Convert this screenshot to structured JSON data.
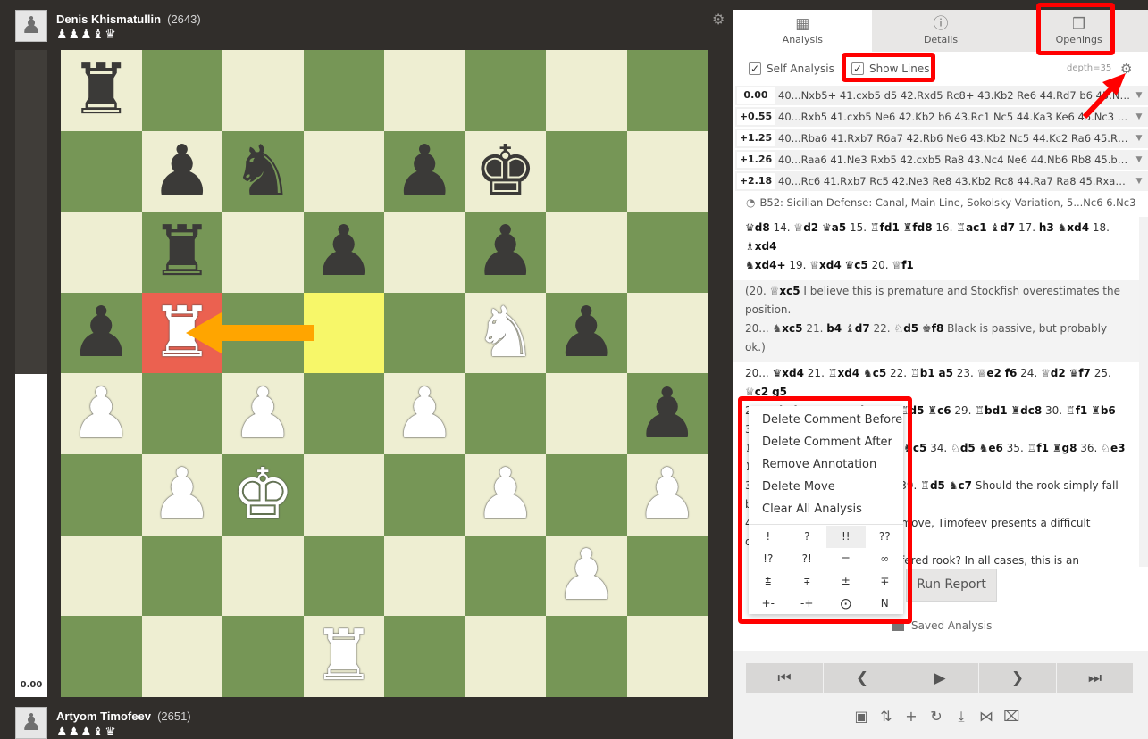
{
  "top_player": {
    "name": "Denis Khismatullin",
    "rating": "(2643)",
    "captured": "♟♟♟♝♛"
  },
  "bottom_player": {
    "name": "Artyom Timofeev",
    "rating": "(2651)",
    "captured": "♟♟♟♝♛"
  },
  "eval_bar": {
    "score": "0.00",
    "white_fraction": 0.5
  },
  "board": {
    "squares": [
      [
        "♜",
        "",
        "",
        "",
        "",
        "",
        "",
        ""
      ],
      [
        "",
        "♟",
        "♞",
        "",
        "♟",
        "♚",
        "",
        ""
      ],
      [
        "",
        "♜",
        "",
        "♟",
        "",
        "♟",
        "",
        ""
      ],
      [
        "♟",
        "♖",
        "",
        "",
        "",
        "♘",
        "♟",
        ""
      ],
      [
        "♙",
        "",
        "♙",
        "",
        "♙",
        "",
        "",
        "♟"
      ],
      [
        "",
        "♙",
        "♔",
        "",
        "",
        "♙",
        "",
        "♙"
      ],
      [
        "",
        "",
        "",
        "",
        "",
        "",
        "♙",
        ""
      ],
      [
        "",
        "",
        "",
        "♖",
        "",
        "",
        "",
        ""
      ]
    ],
    "highlight_from": "b5",
    "highlight_to": "d5"
  },
  "panel": {
    "tabs": [
      {
        "label": "Analysis",
        "icon": "analysis-icon"
      },
      {
        "label": "Details",
        "icon": "info-icon"
      },
      {
        "label": "Openings",
        "icon": "book-icon"
      }
    ],
    "self_analysis_label": "Self Analysis",
    "show_lines_label": "Show Lines",
    "depth": "depth=35",
    "engine_lines": [
      {
        "eval": "0.00",
        "moves": "40...Nxb5+ 41.cxb5 d5 42.Rxd5 Rc8+ 43.Kb2 Re6 44.Rd7 b6 45.Ne…"
      },
      {
        "eval": "+0.55",
        "moves": "40...Rxb5 41.cxb5 Ne6 42.Kb2 b6 43.Rc1 Nc5 44.Ka3 Ke6 45.Nc3 Rb…"
      },
      {
        "eval": "+1.25",
        "moves": "40...Rba6 41.Rxb7 R6a7 42.Rb6 Ne6 43.Kb2 Nc5 44.Kc2 Ra6 45.Rb5 …"
      },
      {
        "eval": "+1.26",
        "moves": "40...Raa6 41.Ne3 Rxb5 42.cxb5 Ra8 43.Nc4 Ne6 44.Nb6 Rb8 45.b4 a…"
      },
      {
        "eval": "+2.18",
        "moves": "40...Rc6 41.Rxb7 Rc5 42.Ne3 Re8 43.Kb2 Rc8 44.Ra7 Ra8 45.Rxa8 N…"
      }
    ],
    "opening": "B52: Sicilian Defense: Canal, Main Line, Sokolsky Variation, 5...Nc6 6.Nc3",
    "run_report_label": "Run Report",
    "saved_analysis_label": "Saved Analysis"
  },
  "context_menu": {
    "items": [
      "Delete Comment Before",
      "Delete Comment After",
      "Remove Annotation",
      "Delete Move",
      "Clear All Analysis"
    ],
    "glyphs": [
      "!",
      "?",
      "!!",
      "??",
      "!?",
      "?!",
      "=",
      "∞",
      "⩲",
      "⩱",
      "±",
      "∓",
      "+-",
      "-+",
      "⨀",
      "N"
    ]
  },
  "annotation_color": "#ff0000",
  "arrow_color": "#ffa500"
}
